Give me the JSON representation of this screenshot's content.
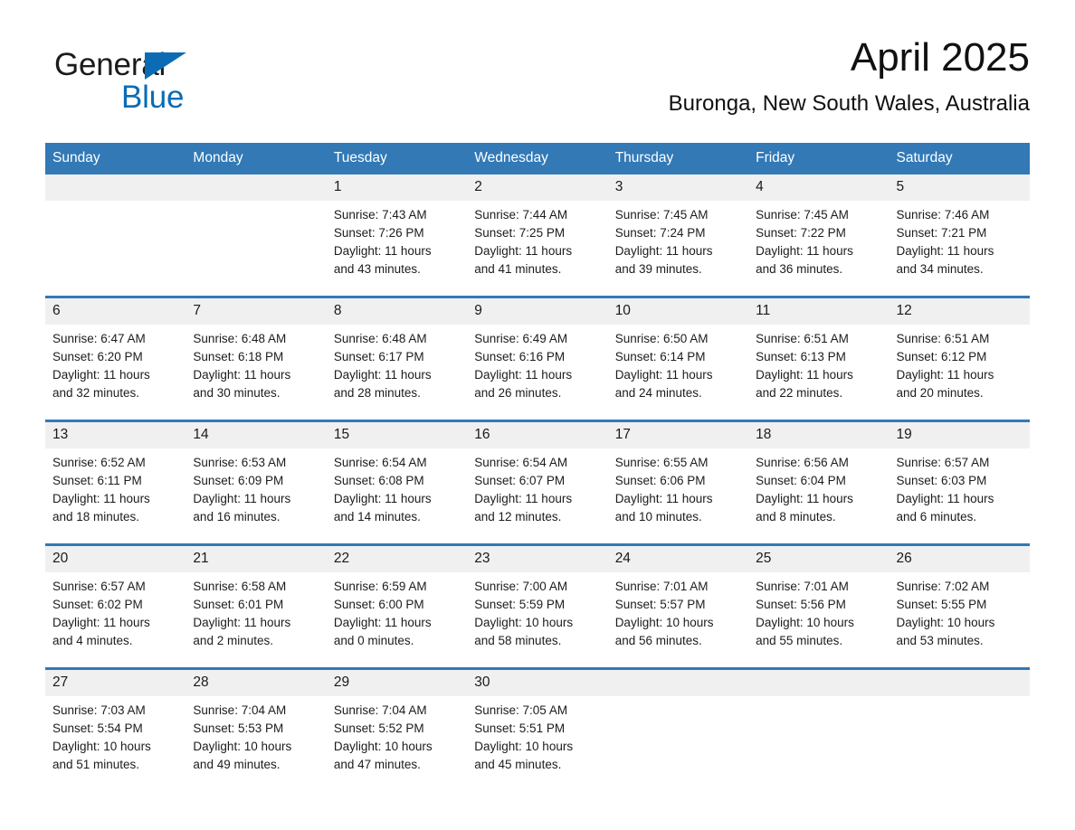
{
  "brand": {
    "word_one": "General",
    "word_two": "Blue",
    "triangle_color": "#0b6cb5",
    "text_color": "#1b1b1b"
  },
  "header": {
    "title": "April 2025",
    "subtitle": "Buronga, New South Wales, Australia"
  },
  "theme": {
    "header_blue": "#3279b6",
    "row_rule_blue": "#3279b6",
    "daynum_background": "#f0f0f0",
    "page_background": "#ffffff"
  },
  "weekdays": [
    "Sunday",
    "Monday",
    "Tuesday",
    "Wednesday",
    "Thursday",
    "Friday",
    "Saturday"
  ],
  "weeks": [
    {
      "days": [
        {
          "num": "",
          "lines": []
        },
        {
          "num": "",
          "lines": []
        },
        {
          "num": "1",
          "lines": [
            "Sunrise: 7:43 AM",
            "Sunset: 7:26 PM",
            "Daylight: 11 hours",
            "and 43 minutes."
          ]
        },
        {
          "num": "2",
          "lines": [
            "Sunrise: 7:44 AM",
            "Sunset: 7:25 PM",
            "Daylight: 11 hours",
            "and 41 minutes."
          ]
        },
        {
          "num": "3",
          "lines": [
            "Sunrise: 7:45 AM",
            "Sunset: 7:24 PM",
            "Daylight: 11 hours",
            "and 39 minutes."
          ]
        },
        {
          "num": "4",
          "lines": [
            "Sunrise: 7:45 AM",
            "Sunset: 7:22 PM",
            "Daylight: 11 hours",
            "and 36 minutes."
          ]
        },
        {
          "num": "5",
          "lines": [
            "Sunrise: 7:46 AM",
            "Sunset: 7:21 PM",
            "Daylight: 11 hours",
            "and 34 minutes."
          ]
        }
      ]
    },
    {
      "days": [
        {
          "num": "6",
          "lines": [
            "Sunrise: 6:47 AM",
            "Sunset: 6:20 PM",
            "Daylight: 11 hours",
            "and 32 minutes."
          ]
        },
        {
          "num": "7",
          "lines": [
            "Sunrise: 6:48 AM",
            "Sunset: 6:18 PM",
            "Daylight: 11 hours",
            "and 30 minutes."
          ]
        },
        {
          "num": "8",
          "lines": [
            "Sunrise: 6:48 AM",
            "Sunset: 6:17 PM",
            "Daylight: 11 hours",
            "and 28 minutes."
          ]
        },
        {
          "num": "9",
          "lines": [
            "Sunrise: 6:49 AM",
            "Sunset: 6:16 PM",
            "Daylight: 11 hours",
            "and 26 minutes."
          ]
        },
        {
          "num": "10",
          "lines": [
            "Sunrise: 6:50 AM",
            "Sunset: 6:14 PM",
            "Daylight: 11 hours",
            "and 24 minutes."
          ]
        },
        {
          "num": "11",
          "lines": [
            "Sunrise: 6:51 AM",
            "Sunset: 6:13 PM",
            "Daylight: 11 hours",
            "and 22 minutes."
          ]
        },
        {
          "num": "12",
          "lines": [
            "Sunrise: 6:51 AM",
            "Sunset: 6:12 PM",
            "Daylight: 11 hours",
            "and 20 minutes."
          ]
        }
      ]
    },
    {
      "days": [
        {
          "num": "13",
          "lines": [
            "Sunrise: 6:52 AM",
            "Sunset: 6:11 PM",
            "Daylight: 11 hours",
            "and 18 minutes."
          ]
        },
        {
          "num": "14",
          "lines": [
            "Sunrise: 6:53 AM",
            "Sunset: 6:09 PM",
            "Daylight: 11 hours",
            "and 16 minutes."
          ]
        },
        {
          "num": "15",
          "lines": [
            "Sunrise: 6:54 AM",
            "Sunset: 6:08 PM",
            "Daylight: 11 hours",
            "and 14 minutes."
          ]
        },
        {
          "num": "16",
          "lines": [
            "Sunrise: 6:54 AM",
            "Sunset: 6:07 PM",
            "Daylight: 11 hours",
            "and 12 minutes."
          ]
        },
        {
          "num": "17",
          "lines": [
            "Sunrise: 6:55 AM",
            "Sunset: 6:06 PM",
            "Daylight: 11 hours",
            "and 10 minutes."
          ]
        },
        {
          "num": "18",
          "lines": [
            "Sunrise: 6:56 AM",
            "Sunset: 6:04 PM",
            "Daylight: 11 hours",
            "and 8 minutes."
          ]
        },
        {
          "num": "19",
          "lines": [
            "Sunrise: 6:57 AM",
            "Sunset: 6:03 PM",
            "Daylight: 11 hours",
            "and 6 minutes."
          ]
        }
      ]
    },
    {
      "days": [
        {
          "num": "20",
          "lines": [
            "Sunrise: 6:57 AM",
            "Sunset: 6:02 PM",
            "Daylight: 11 hours",
            "and 4 minutes."
          ]
        },
        {
          "num": "21",
          "lines": [
            "Sunrise: 6:58 AM",
            "Sunset: 6:01 PM",
            "Daylight: 11 hours",
            "and 2 minutes."
          ]
        },
        {
          "num": "22",
          "lines": [
            "Sunrise: 6:59 AM",
            "Sunset: 6:00 PM",
            "Daylight: 11 hours",
            "and 0 minutes."
          ]
        },
        {
          "num": "23",
          "lines": [
            "Sunrise: 7:00 AM",
            "Sunset: 5:59 PM",
            "Daylight: 10 hours",
            "and 58 minutes."
          ]
        },
        {
          "num": "24",
          "lines": [
            "Sunrise: 7:01 AM",
            "Sunset: 5:57 PM",
            "Daylight: 10 hours",
            "and 56 minutes."
          ]
        },
        {
          "num": "25",
          "lines": [
            "Sunrise: 7:01 AM",
            "Sunset: 5:56 PM",
            "Daylight: 10 hours",
            "and 55 minutes."
          ]
        },
        {
          "num": "26",
          "lines": [
            "Sunrise: 7:02 AM",
            "Sunset: 5:55 PM",
            "Daylight: 10 hours",
            "and 53 minutes."
          ]
        }
      ]
    },
    {
      "days": [
        {
          "num": "27",
          "lines": [
            "Sunrise: 7:03 AM",
            "Sunset: 5:54 PM",
            "Daylight: 10 hours",
            "and 51 minutes."
          ]
        },
        {
          "num": "28",
          "lines": [
            "Sunrise: 7:04 AM",
            "Sunset: 5:53 PM",
            "Daylight: 10 hours",
            "and 49 minutes."
          ]
        },
        {
          "num": "29",
          "lines": [
            "Sunrise: 7:04 AM",
            "Sunset: 5:52 PM",
            "Daylight: 10 hours",
            "and 47 minutes."
          ]
        },
        {
          "num": "30",
          "lines": [
            "Sunrise: 7:05 AM",
            "Sunset: 5:51 PM",
            "Daylight: 10 hours",
            "and 45 minutes."
          ]
        },
        {
          "num": "",
          "lines": []
        },
        {
          "num": "",
          "lines": []
        },
        {
          "num": "",
          "lines": []
        }
      ]
    }
  ]
}
